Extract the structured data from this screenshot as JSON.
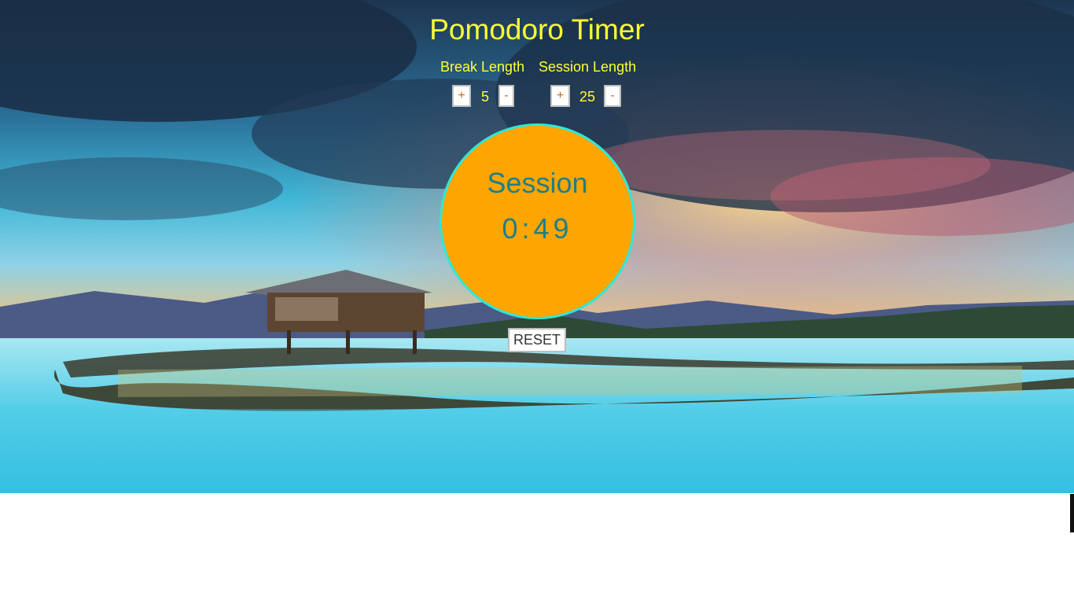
{
  "app": {
    "title": "Pomodoro Timer"
  },
  "break": {
    "label": "Break Length",
    "value": "5",
    "plus_label": "+",
    "minus_label": "-"
  },
  "session": {
    "label": "Session Length",
    "value": "25",
    "plus_label": "+",
    "minus_label": "-"
  },
  "clock": {
    "label": "Session",
    "time": "0:49"
  },
  "controls": {
    "reset_label": "RESET"
  },
  "colors": {
    "accent_text": "#ffff33",
    "clock_fill": "#ffa500",
    "clock_border": "#2de8d9",
    "clock_text": "#1e7f86",
    "button_text": "#c46a14"
  }
}
